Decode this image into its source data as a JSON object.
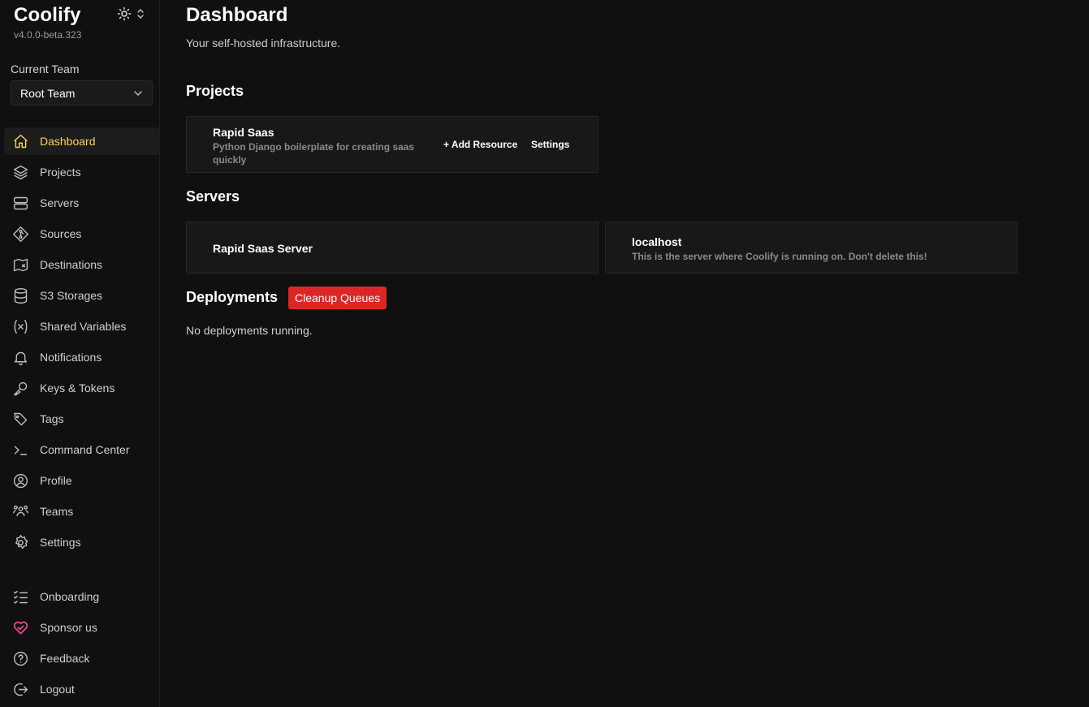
{
  "app": {
    "name": "Coolify",
    "version": "v4.0.0-beta.323"
  },
  "team": {
    "label": "Current Team",
    "selected": "Root Team"
  },
  "nav": [
    {
      "label": "Dashboard",
      "icon": "home-icon",
      "active": true
    },
    {
      "label": "Projects",
      "icon": "layers-icon"
    },
    {
      "label": "Servers",
      "icon": "server-icon"
    },
    {
      "label": "Sources",
      "icon": "git-icon"
    },
    {
      "label": "Destinations",
      "icon": "destination-icon"
    },
    {
      "label": "S3 Storages",
      "icon": "database-icon"
    },
    {
      "label": "Shared Variables",
      "icon": "variable-icon"
    },
    {
      "label": "Notifications",
      "icon": "bell-icon"
    },
    {
      "label": "Keys & Tokens",
      "icon": "key-icon"
    },
    {
      "label": "Tags",
      "icon": "tags-icon"
    },
    {
      "label": "Command Center",
      "icon": "terminal-icon"
    },
    {
      "label": "Profile",
      "icon": "user-circle-icon"
    },
    {
      "label": "Teams",
      "icon": "users-icon"
    },
    {
      "label": "Settings",
      "icon": "gear-icon"
    }
  ],
  "nav_bottom": [
    {
      "label": "Onboarding",
      "icon": "checklist-icon"
    },
    {
      "label": "Sponsor us",
      "icon": "heart-handshake-icon"
    },
    {
      "label": "Feedback",
      "icon": "question-icon"
    },
    {
      "label": "Logout",
      "icon": "logout-icon"
    }
  ],
  "page": {
    "title": "Dashboard",
    "subtitle": "Your self-hosted infrastructure."
  },
  "projects": {
    "title": "Projects",
    "items": [
      {
        "name": "Rapid Saas",
        "description": "Python Django boilerplate for creating saas quickly",
        "add_resource": "+ Add Resource",
        "settings": "Settings"
      }
    ]
  },
  "servers": {
    "title": "Servers",
    "items": [
      {
        "name": "Rapid Saas Server",
        "description": ""
      },
      {
        "name": "localhost",
        "description": "This is the server where Coolify is running on. Don't delete this!"
      }
    ]
  },
  "deployments": {
    "title": "Deployments",
    "cleanup_button": "Cleanup Queues",
    "empty": "No deployments running."
  },
  "colors": {
    "accent": "#fcd452",
    "danger": "#dc2626",
    "background": "#101010",
    "card": "#181818"
  }
}
